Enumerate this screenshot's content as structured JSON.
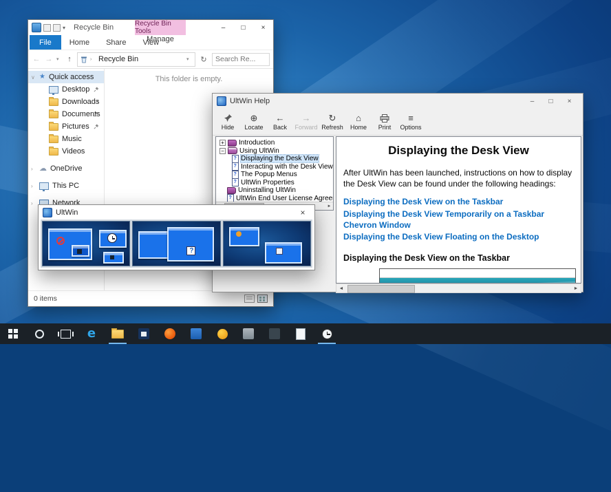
{
  "glyphs": {
    "minimize": "–",
    "maximize": "□",
    "close": "×",
    "back_arrow": "←",
    "forward_arrow": "→",
    "up_arrow": "↑",
    "refresh": "↻",
    "home": "⌂",
    "dropdown": "▾",
    "expand_down": "∨",
    "chevron_right": "›",
    "plus": "+",
    "minus": "−",
    "scroll_left": "◄",
    "scroll_right": "►",
    "star": "★",
    "cloud": "☁",
    "locate_icon": "⊕",
    "options_icon": "≡",
    "edge_e": "e"
  },
  "colors": {
    "accent_blue": "#1979ca",
    "contextual_pink": "#f2bfe1",
    "link_blue": "#0b6cc0",
    "taskbar_bg": "#1b2127"
  },
  "explorer": {
    "title": "Recycle Bin",
    "contextual_group": "Recycle Bin Tools",
    "tabs": [
      "File",
      "Home",
      "Share",
      "View"
    ],
    "manage_tab": "Manage",
    "breadcrumb": "Recycle Bin",
    "search_placeholder": "Search Re...",
    "sidebar": {
      "quick_access": "Quick access",
      "items": [
        {
          "label": "Desktop",
          "pinned": true
        },
        {
          "label": "Downloads",
          "pinned": true
        },
        {
          "label": "Documents",
          "pinned": true
        },
        {
          "label": "Pictures",
          "pinned": true
        },
        {
          "label": "Music",
          "pinned": false
        },
        {
          "label": "Videos",
          "pinned": false
        }
      ],
      "roots": [
        "OneDrive",
        "This PC",
        "Network"
      ]
    },
    "empty_text": "This folder is empty.",
    "status": "0 items"
  },
  "help": {
    "title": "UltWin Help",
    "toolbar": [
      "Hide",
      "Locate",
      "Back",
      "Forward",
      "Refresh",
      "Home",
      "Print",
      "Options"
    ],
    "tree": [
      {
        "label": "Introduction"
      },
      {
        "label": "Using UltWin"
      },
      {
        "label": "Displaying the Desk View"
      },
      {
        "label": "Interacting with the Desk View"
      },
      {
        "label": "The Popup Menus"
      },
      {
        "label": "UltWin Properties"
      },
      {
        "label": "Uninstalling UltWin"
      },
      {
        "label": "UltWin End User License Agreement"
      }
    ],
    "content": {
      "heading": "Displaying the Desk View",
      "intro": "After UltWin has been launched, instructions on how to display the Desk View can be found under the following headings:",
      "links": [
        "Displaying the Desk View on the Taskbar",
        "Displaying the Desk View Temporarily on a Taskbar Chevron Window",
        "Displaying the Desk View Floating on the Desktop"
      ],
      "section_heading": "Displaying the Desk View on the Taskbar"
    }
  },
  "ultwin": {
    "title": "UltWin"
  },
  "taskbar": {
    "icons": [
      "start",
      "search",
      "task-view",
      "edge",
      "file-explorer",
      "store",
      "firefox",
      "app-blue",
      "app-orange",
      "app-gray",
      "app-dark",
      "app-doc",
      "ultwin-clock"
    ]
  }
}
